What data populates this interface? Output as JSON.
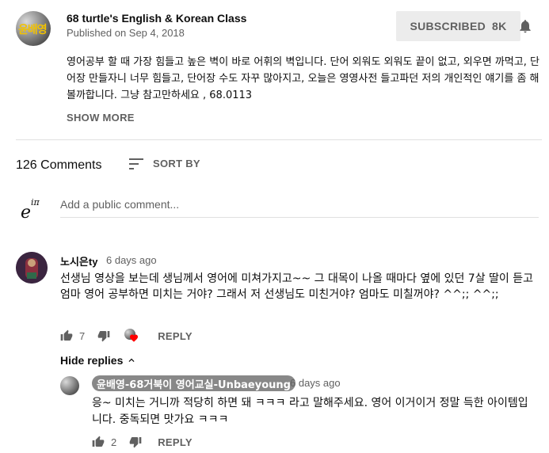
{
  "video": {
    "channel_name": "68 turtle's English & Korean Class",
    "published": "Published on Sep 4, 2018",
    "subscribe_label": "SUBSCRIBED",
    "subscriber_count": "8K",
    "channel_logo_text": "윤배영",
    "description": "영어공부 할 때 가장 힘들고 높은 벽이 바로 어휘의 벽입니다. 단어 외워도 외워도 끝이 없고, 외우면 까먹고, 단어장 만들자니 너무 힘들고, 단어장 수도 자꾸 많아지고, 오늘은 영영사전 들고파던 저의 개인적인 얘기를 좀 해볼까합니다. 그냥 참고만하세요 , 68.0113",
    "show_more_label": "SHOW MORE"
  },
  "comments_header": {
    "count_label": "126 Comments",
    "sort_label": "SORT BY"
  },
  "add_comment": {
    "avatar_text": "e",
    "avatar_sup": "iπ",
    "placeholder": "Add a public comment..."
  },
  "comment": {
    "author": "노시은ty",
    "time": "6 days ago",
    "text": "선생님  영상을 보는데  생님께서 영어에 미쳐가지고~~ 그 대목이 나올 때마다 옆에 있던 7살 딸이 듣고 엄마 영어 공부하면 미치는 거야? 그래서 저 선생님도 미친거야? 엄마도 미칠꺼야? ^^;; ^^;;",
    "like_count": "7",
    "reply_label": "REPLY",
    "hide_replies_label": "Hide replies"
  },
  "reply": {
    "author": "윤배영-68거북이 영어교실-Unbaeyoung",
    "time": "6 days ago",
    "text": "응~ 미치는 거니까 적당히 하면 돼 ㅋㅋㅋ 라고 말해주세요. 영어 이거이거 정말 득한 아이템입니다. 중독되면 맛가요 ㅋㅋㅋ",
    "like_count": "2",
    "reply_label": "REPLY"
  },
  "colors": {
    "text_primary": "#0d0d0d",
    "text_secondary": "#606060",
    "subscribed_bg": "#ececec",
    "author_badge_bg": "#888888",
    "heart": "#ff0000"
  }
}
